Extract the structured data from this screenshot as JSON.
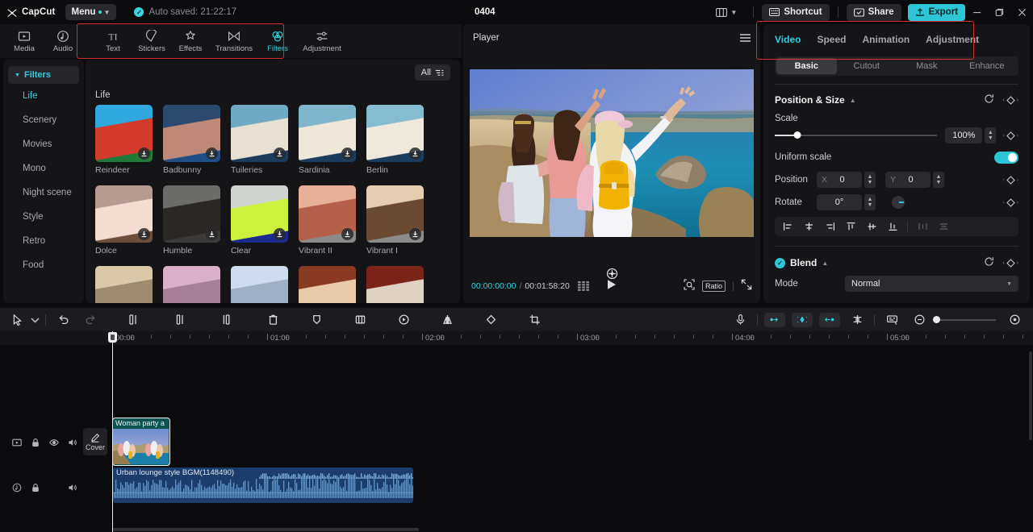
{
  "titlebar": {
    "brand": "CapCut",
    "menu_label": "Menu",
    "autosave": "Auto saved: 21:22:17",
    "project_title": "0404",
    "shortcut_label": "Shortcut",
    "share_label": "Share",
    "export_label": "Export",
    "minimize_icon": "minimize-icon",
    "maximize_icon": "maximize-icon",
    "close_icon": "close-icon"
  },
  "toolbar": {
    "tabs": [
      {
        "label": "Media",
        "icon": "media-icon",
        "active": false
      },
      {
        "label": "Audio",
        "icon": "audio-icon",
        "active": false
      },
      {
        "label": "Text",
        "icon": "text-icon",
        "active": false
      },
      {
        "label": "Stickers",
        "icon": "stickers-icon",
        "active": false
      },
      {
        "label": "Effects",
        "icon": "effects-icon",
        "active": false
      },
      {
        "label": "Transitions",
        "icon": "transitions-icon",
        "active": false
      },
      {
        "label": "Filters",
        "icon": "filters-icon",
        "active": true
      },
      {
        "label": "Adjustment",
        "icon": "adjustment-icon",
        "active": false
      }
    ]
  },
  "sidebar": {
    "header": "Filters",
    "items": [
      {
        "label": "Life",
        "active": true
      },
      {
        "label": "Scenery",
        "active": false
      },
      {
        "label": "Movies",
        "active": false
      },
      {
        "label": "Mono",
        "active": false
      },
      {
        "label": "Night scene",
        "active": false
      },
      {
        "label": "Style",
        "active": false
      },
      {
        "label": "Retro",
        "active": false
      },
      {
        "label": "Food",
        "active": false
      }
    ]
  },
  "filters_panel": {
    "all_label": "All",
    "group_title": "Life",
    "items": [
      {
        "name": "Reindeer",
        "c1": "#2fa8dd",
        "c2": "#d33a2c",
        "c3": "#1f7a3a"
      },
      {
        "name": "Badbunny",
        "c1": "#2c4a6e",
        "c2": "#c08878",
        "c3": "#1d4f86"
      },
      {
        "name": "Tuileries",
        "c1": "#6fa9c4",
        "c2": "#e8e0d2",
        "c3": "#1b3c5c"
      },
      {
        "name": "Sardinia",
        "c1": "#7fb6cc",
        "c2": "#efe7da",
        "c3": "#1b3c5c"
      },
      {
        "name": "Berlin",
        "c1": "#86bccf",
        "c2": "#efe8dc",
        "c3": "#1b3c5c"
      },
      {
        "name": "Dolce",
        "c1": "#b59b92",
        "c2": "#f3dcd2",
        "c3": "#6d4e3c"
      },
      {
        "name": "Humble",
        "c1": "#6c6c6a",
        "c2": "#2a2724",
        "c3": "#3b3a38"
      },
      {
        "name": "Clear",
        "c1": "#cfd3cf",
        "c2": "#cdf23e",
        "c3": "#1b2a8c"
      },
      {
        "name": "Vibrant II",
        "c1": "#e8b096",
        "c2": "#b4604a",
        "c3": "#8b8b8b"
      },
      {
        "name": "Vibrant I",
        "c1": "#e4cdb0",
        "c2": "#6b4a33",
        "c3": "#8b8b8b"
      },
      {
        "name": "",
        "c1": "#d9c9a8",
        "c2": "#9c8b6e",
        "c3": "#c8b695"
      },
      {
        "name": "",
        "c1": "#d9b0c8",
        "c2": "#a77f98",
        "c3": "#c89cb8"
      },
      {
        "name": "",
        "c1": "#cfdcee",
        "c2": "#9fb0c4",
        "c3": "#bcc9da"
      },
      {
        "name": "",
        "c1": "#8b3a22",
        "c2": "#e8c9a8",
        "c3": "#6d2a18"
      },
      {
        "name": "",
        "c1": "#7a2418",
        "c2": "#ded2c4",
        "c3": "#5e1d12"
      }
    ]
  },
  "player": {
    "title": "Player",
    "menu_icon": "hamburger-icon",
    "current_time": "00:00:00:00",
    "total_time": "00:01:58:20",
    "separator": "/",
    "frames_icon": "frames-icon",
    "play_icon": "play-icon",
    "crop_icon": "crop-zoom-icon",
    "ratio_label": "Ratio",
    "fullscreen_icon": "fullscreen-icon",
    "center_marker_icon": "center-marker-icon"
  },
  "inspector": {
    "tabs": [
      {
        "label": "Video",
        "active": true
      },
      {
        "label": "Speed",
        "active": false
      },
      {
        "label": "Animation",
        "active": false
      },
      {
        "label": "Adjustment",
        "active": false
      }
    ],
    "segments": [
      {
        "label": "Basic",
        "active": true
      },
      {
        "label": "Cutout",
        "active": false
      },
      {
        "label": "Mask",
        "active": false
      },
      {
        "label": "Enhance",
        "active": false
      }
    ],
    "position_size": {
      "title": "Position & Size",
      "reset_icon": "reset-icon",
      "keyframe_icon": "keyframe-diamond-icon",
      "scale_label": "Scale",
      "scale_value": "100%",
      "uniform_label": "Uniform scale",
      "uniform_on": true,
      "position_label": "Position",
      "x_axis": "X",
      "x_value": "0",
      "y_axis": "Y",
      "y_value": "0",
      "rotate_label": "Rotate",
      "rotate_value": "0°"
    },
    "align_buttons": [
      "align-left-icon",
      "align-center-h-icon",
      "align-right-icon",
      "align-top-icon",
      "align-middle-v-icon",
      "align-bottom-icon",
      "distribute-h-icon",
      "distribute-v-icon"
    ],
    "blend": {
      "title": "Blend",
      "enabled": true,
      "reset_icon": "reset-icon",
      "keyframe_icon": "keyframe-diamond-icon",
      "mode_label": "Mode",
      "mode_value": "Normal"
    }
  },
  "timeline": {
    "tools": [
      "select-arrow-icon",
      "chevron-down-icon",
      "undo-icon",
      "redo-icon",
      "split-icon",
      "trim-left-icon",
      "trim-right-icon",
      "delete-icon",
      "marker-icon",
      "freeze-icon",
      "reverse-icon",
      "mirror-icon",
      "rotate-icon",
      "crop-icon"
    ],
    "right_tools": [
      "mic-icon",
      "keyframe-prev-icon",
      "keyframe-add-icon",
      "keyframe-next-icon",
      "split-clip-icon",
      "auto-caption-icon",
      "zoom-out-icon",
      "zoom-in-icon"
    ],
    "ruler_labels": [
      "00:00",
      "01:00",
      "02:00",
      "03:00",
      "04:00",
      "05:00"
    ],
    "cover_label": "Cover",
    "video_clip": {
      "name": "Woman party a"
    },
    "audio_clip": {
      "name": "Urban lounge style BGM(1148490)"
    },
    "track_controls_video": [
      "thumbnail-toggle-icon",
      "lock-icon",
      "eye-icon",
      "volume-icon"
    ],
    "track_controls_audio": [
      "audio-track-icon",
      "lock-icon",
      "blank-icon",
      "volume-icon"
    ]
  },
  "colors": {
    "accent": "#2fd0de",
    "export": "#2cc6d6",
    "highlight_box": "#d0312d",
    "panel_bg": "#151518",
    "app_bg": "#0b0b0d"
  }
}
